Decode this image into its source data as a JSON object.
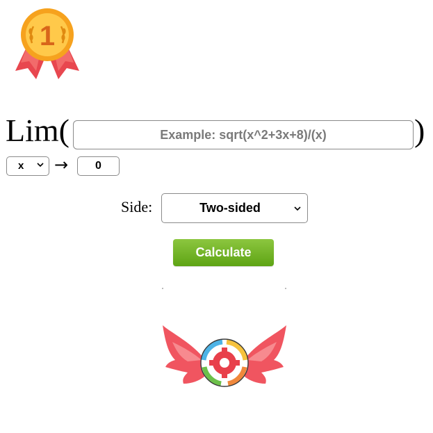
{
  "badge": {
    "number": "1",
    "icon": "medal-icon"
  },
  "limit": {
    "lim_word": "Lim(",
    "close_paren": ")",
    "expression": {
      "value": "",
      "placeholder": "Example: sqrt(x^2+3x+8)/(x)"
    },
    "variable": {
      "selected": "x",
      "icon": "chevron-down-icon"
    },
    "arrow": "→",
    "approach_value": "0"
  },
  "side": {
    "label": "Side:",
    "selected": "Two-sided",
    "icon": "chevron-down-icon"
  },
  "calculate_button": {
    "label": "Calculate",
    "color_top": "#8cc63f",
    "color_bottom": "#5ea414"
  },
  "logo": {
    "icon": "winged-gear-cycle-icon",
    "wing_color": "#f0525e"
  }
}
